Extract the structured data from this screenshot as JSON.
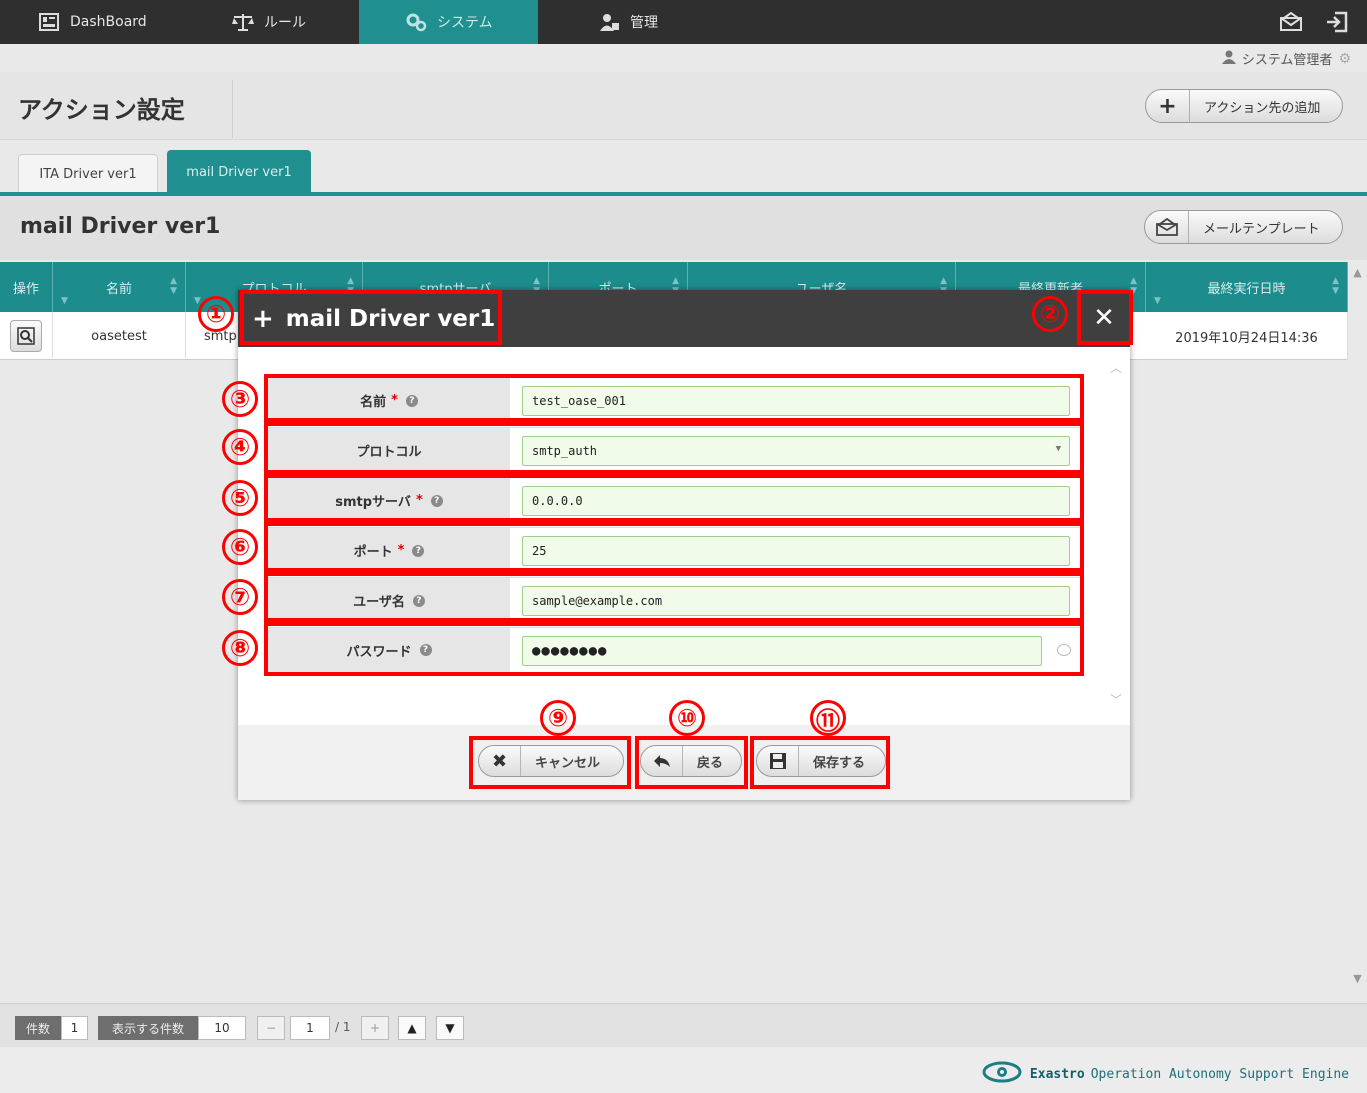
{
  "nav": {
    "items": [
      {
        "label": "DashBoard",
        "icon": "dashboard-icon"
      },
      {
        "label": "ルール",
        "icon": "scale-icon"
      },
      {
        "label": "システム",
        "icon": "gears-icon"
      },
      {
        "label": "管理",
        "icon": "user-admin-icon"
      }
    ],
    "active_index": 2
  },
  "user": {
    "name": "システム管理者"
  },
  "page": {
    "title": "アクション設定",
    "add_button": "アクション先の追加"
  },
  "tabs": [
    "ITA Driver ver1",
    "mail Driver ver1"
  ],
  "section": {
    "title": "mail Driver ver1",
    "template_button": "メールテンプレート"
  },
  "table": {
    "headers": [
      "操作",
      "名前",
      "プロトコル",
      "smtpサーバ",
      "ポート",
      "ユーザ名",
      "最終更新者",
      "最終実行日時"
    ],
    "row": {
      "name": "oasetest",
      "protocol": "smtp",
      "last_exec": "2019年10月24日14:36"
    }
  },
  "modal": {
    "title": "mail Driver ver1",
    "fields": [
      {
        "label": "名前",
        "required": true,
        "value": "test_oase_001"
      },
      {
        "label": "プロトコル",
        "required": false,
        "value": "smtp_auth"
      },
      {
        "label": "smtpサーバ",
        "required": true,
        "value": "0.0.0.0"
      },
      {
        "label": "ポート",
        "required": true,
        "value": "25"
      },
      {
        "label": "ユーザ名",
        "required": false,
        "value": "sample@example.com"
      },
      {
        "label": "パスワード",
        "required": false,
        "value": "●●●●●●●●"
      }
    ],
    "buttons": {
      "cancel": "キャンセル",
      "back": "戻る",
      "save": "保存する"
    }
  },
  "annotations": [
    "①",
    "②",
    "③",
    "④",
    "⑤",
    "⑥",
    "⑦",
    "⑧",
    "⑨",
    "⑩",
    "⑪"
  ],
  "pager": {
    "count_label": "件数",
    "count": "1",
    "per_page_label": "表示する件数",
    "per_page": "10",
    "page": "1",
    "total_pages": "/ 1"
  },
  "brand": {
    "name": "Exastro",
    "tagline": "Operation Autonomy Support Engine"
  },
  "colors": {
    "accent": "#1f8f8f",
    "annotation": "#ff0000",
    "nav_bg": "#2f2f2f"
  }
}
